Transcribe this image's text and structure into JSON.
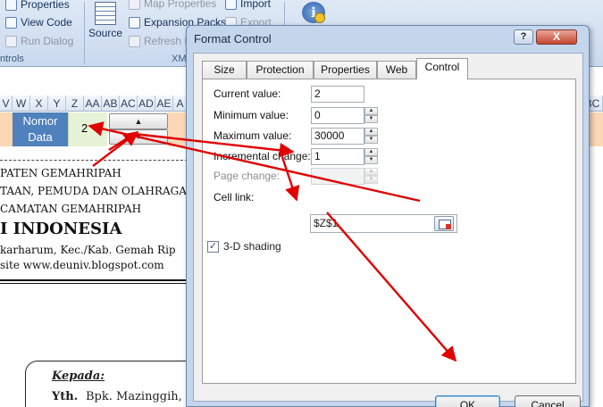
{
  "ribbon": {
    "items": [
      {
        "label": "Properties"
      },
      {
        "label": "View Code"
      },
      {
        "label": "Run Dialog"
      },
      {
        "label": "Source"
      },
      {
        "label": "Map Properties"
      },
      {
        "label": "Expansion Packs"
      },
      {
        "label": "Refresh D"
      },
      {
        "label": "Import"
      },
      {
        "label": "Export"
      }
    ],
    "group_left": "ntrols",
    "group_xml": "XM"
  },
  "columns": [
    "V",
    "W",
    "X",
    "Y",
    "Z",
    "AA",
    "AB",
    "AC",
    "AD",
    "AE",
    "A",
    "BC"
  ],
  "sheet": {
    "nomor_label": "Nomor\nData",
    "value": "2",
    "doc_lines": [
      "PATEN GEMAHRIPAH",
      "TAAN, PEMUDA DAN OLAHRAGA",
      "CAMATAN GEMAHRIPAH",
      "I INDONESIA",
      "karharum, Kec./Kab. Gemah Rip",
      "site www.deuniv.blogspot.com"
    ],
    "kepada": "Kepada:",
    "yth": "Yth.",
    "yth_name": "Bpk. Mazinggih, M"
  },
  "dialog": {
    "title": "Format Control",
    "help": "?",
    "close": "X",
    "tabs": [
      "Size",
      "Protection",
      "Properties",
      "Web",
      "Control"
    ],
    "active_tab": "Control",
    "current_value_label": "Current value:",
    "current_value": "2",
    "minimum_value_label": "Minimum value:",
    "minimum_value": "0",
    "maximum_value_label": "Maximum value:",
    "maximum_value": "30000",
    "incremental_change_label": "Incremental change:",
    "incremental_change": "1",
    "page_change_label": "Page change:",
    "page_change": "",
    "cell_link_label": "Cell link:",
    "cell_link": "$Z$1",
    "shading_label": "3-D shading",
    "shading_checked": true,
    "ok": "OK",
    "cancel": "Cancel"
  },
  "colors": {
    "ribbon_bg": "#c9d9ee",
    "dialog_frame": "#c4d6ec",
    "nomor_bg": "#4f81bd",
    "value_bg": "#e6f3d7",
    "peach": "#fbd7b5",
    "arrow": "#e00000"
  }
}
